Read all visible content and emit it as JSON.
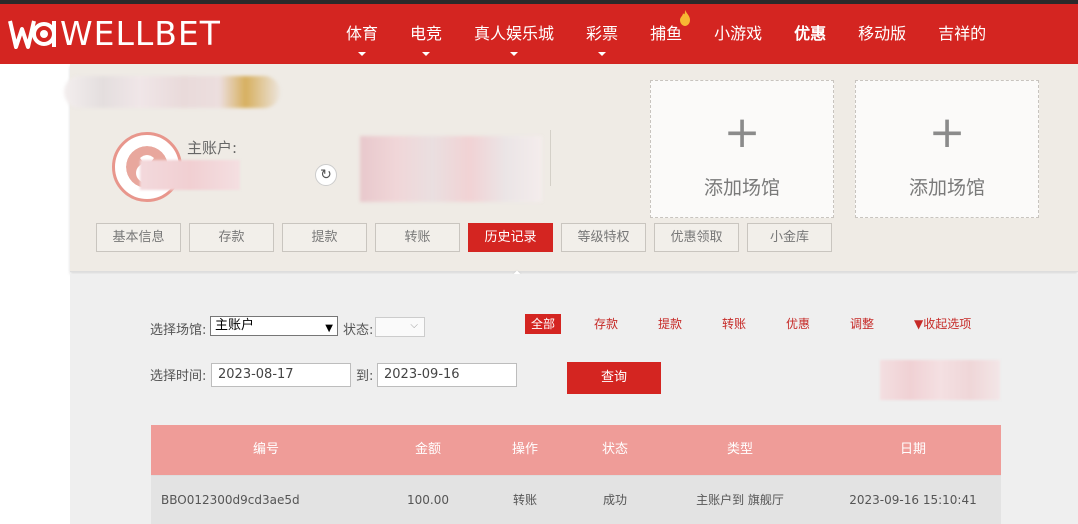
{
  "brand": {
    "logo_text": "WELLBET",
    "accent": "#d42521"
  },
  "nav": {
    "items": [
      {
        "label": "体育",
        "caret": true
      },
      {
        "label": "电竞",
        "caret": true
      },
      {
        "label": "真人娱乐城",
        "caret": true
      },
      {
        "label": "彩票",
        "caret": true
      },
      {
        "label": "捕鱼",
        "caret": false,
        "icon": "fire-icon"
      },
      {
        "label": "小游戏",
        "caret": false
      },
      {
        "label": "优惠",
        "caret": false,
        "bold": true
      },
      {
        "label": "移动版",
        "caret": false
      },
      {
        "label": "吉祥的",
        "caret": false
      }
    ]
  },
  "account": {
    "main_label": "主账户:",
    "add_venue_label": "添加场馆",
    "add_icon": "+"
  },
  "tabs": [
    {
      "label": "基本信息",
      "active": false
    },
    {
      "label": "存款",
      "active": false
    },
    {
      "label": "提款",
      "active": false
    },
    {
      "label": "转账",
      "active": false
    },
    {
      "label": "历史记录",
      "active": true
    },
    {
      "label": "等级特权",
      "active": false
    },
    {
      "label": "优惠领取",
      "active": false
    },
    {
      "label": "小金库",
      "active": false
    }
  ],
  "filters": {
    "venue_label": "选择场馆:",
    "venue_value": "主账户",
    "status_label": "状态:",
    "time_label": "选择时间:",
    "to_label": "到:",
    "start_date": "2023-08-17",
    "end_date": "2023-09-16",
    "query_label": "查询",
    "types": [
      "全部",
      "存款",
      "提款",
      "转账",
      "优惠",
      "调整"
    ],
    "collapse_label": "▼收起选项"
  },
  "table": {
    "headers": [
      "编号",
      "金额",
      "操作",
      "状态",
      "类型",
      "日期"
    ],
    "rows": [
      [
        "BBO012300d9cd3ae5d",
        "100.00",
        "转账",
        "成功",
        "主账户到 旗舰厅",
        "2023-09-16 15:10:41"
      ]
    ]
  }
}
